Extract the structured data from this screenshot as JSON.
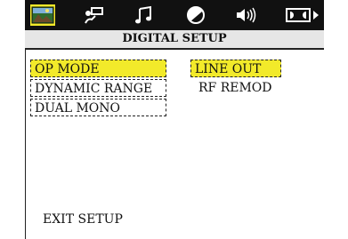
{
  "colors": {
    "topbar": "#111111",
    "highlight": "#f2ea2a",
    "title_bg": "#e6e6e6"
  },
  "toolbar": {
    "icons": [
      {
        "name": "landscape-icon",
        "active": true
      },
      {
        "name": "speaker-microphone-icon",
        "active": false
      },
      {
        "name": "music-note-icon",
        "active": false
      },
      {
        "name": "contrast-icon",
        "active": false
      },
      {
        "name": "volume-icon",
        "active": false
      },
      {
        "name": "dolby-icon",
        "active": false
      }
    ]
  },
  "header": {
    "title": "DIGITAL SETUP"
  },
  "menu": {
    "left_items": [
      "OP MODE",
      "DYNAMIC RANGE",
      "DUAL MONO"
    ],
    "selected_left": "OP MODE",
    "right_items": [
      "LINE OUT",
      "RF REMOD"
    ],
    "selected_right": "LINE OUT"
  },
  "footer": {
    "exit_label": "EXIT SETUP"
  }
}
